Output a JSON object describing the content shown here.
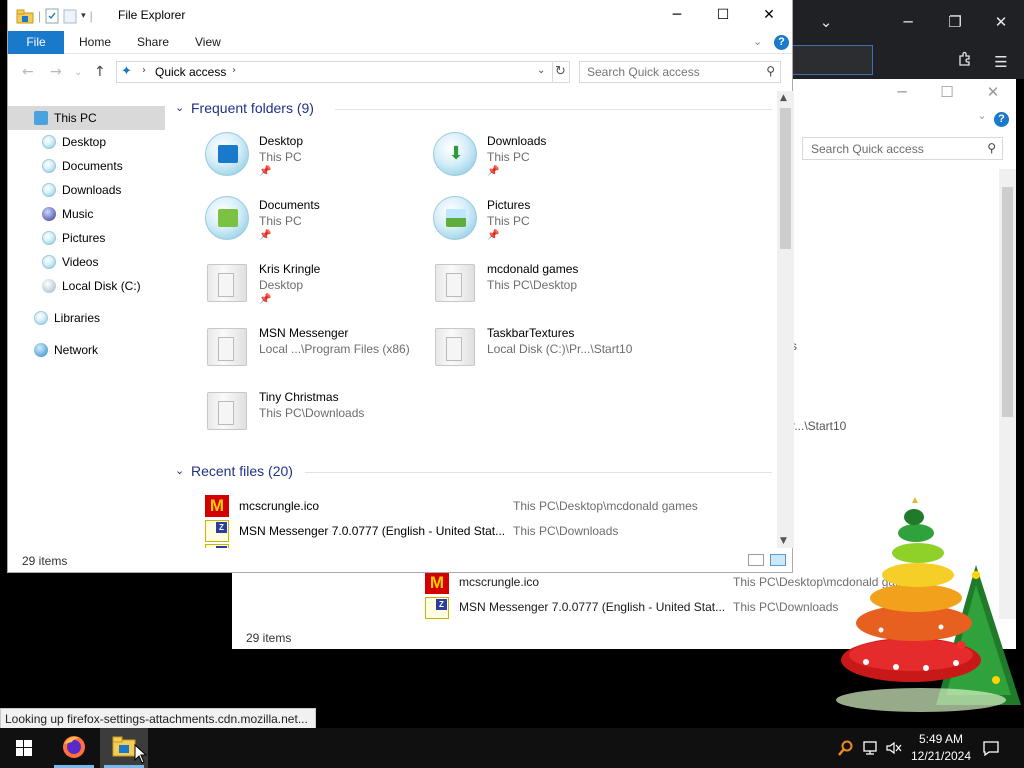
{
  "bg_browser": {
    "minimize": "─",
    "restore": "❐",
    "close": "✕",
    "dropdown": "⌄",
    "menu": "☰",
    "extensions_icon": "puzzle-icon"
  },
  "bg_explorer": {
    "search_placeholder": "Search Quick access",
    "fragment_1": "s",
    "fragment_2": "r...\\Start10",
    "status": "29 items",
    "files": [
      {
        "name": "mcscrungle.ico",
        "path": "This PC\\Desktop\\mcdonald games"
      },
      {
        "name": "MSN Messenger 7.0.0777 (English - United Stat...",
        "path": "This PC\\Downloads"
      }
    ]
  },
  "window": {
    "title": "File Explorer",
    "minimize": "─",
    "maximize": "☐",
    "close": "✕"
  },
  "ribbon": {
    "tabs": [
      "File",
      "Home",
      "Share",
      "View"
    ],
    "help": "?"
  },
  "address": {
    "back": "←",
    "forward": "→",
    "recent": "⌄",
    "up": "↑",
    "crumb": "Quick access",
    "refresh": "↻",
    "search_placeholder": "Search Quick access"
  },
  "nav": {
    "items": [
      {
        "label": "This PC"
      },
      {
        "label": "Desktop"
      },
      {
        "label": "Documents"
      },
      {
        "label": "Downloads"
      },
      {
        "label": "Music"
      },
      {
        "label": "Pictures"
      },
      {
        "label": "Videos"
      },
      {
        "label": "Local Disk (C:)"
      },
      {
        "label": "Libraries"
      },
      {
        "label": "Network"
      }
    ]
  },
  "frequent": {
    "title": "Frequent folders (9)",
    "folders": [
      {
        "name": "Desktop",
        "location": "This PC",
        "icon": "desktop-folder-icon",
        "pinned": true
      },
      {
        "name": "Downloads",
        "location": "This PC",
        "icon": "downloads-folder-icon",
        "pinned": true
      },
      {
        "name": "Documents",
        "location": "This PC",
        "icon": "documents-folder-icon",
        "pinned": true
      },
      {
        "name": "Pictures",
        "location": "This PC",
        "icon": "pictures-folder-icon",
        "pinned": true
      },
      {
        "name": "Kris Kringle",
        "location": "Desktop",
        "icon": "folder-icon",
        "pinned": true
      },
      {
        "name": "mcdonald games",
        "location": "This PC\\Desktop",
        "icon": "folder-icon",
        "pinned": false
      },
      {
        "name": "MSN Messenger",
        "location": "Local ...\\Program Files (x86)",
        "icon": "folder-icon",
        "pinned": false
      },
      {
        "name": "TaskbarTextures",
        "location": "Local Disk (C:)\\Pr...\\Start10",
        "icon": "folder-icon",
        "pinned": false
      },
      {
        "name": "Tiny Christmas",
        "location": "This PC\\Downloads",
        "icon": "folder-icon",
        "pinned": false
      }
    ]
  },
  "recent": {
    "title": "Recent files (20)",
    "files": [
      {
        "name": "mcscrungle.ico",
        "path": "This PC\\Desktop\\mcdonald games",
        "icon": "mcdonalds-icon"
      },
      {
        "name": "MSN Messenger 7.0.0777 (English - United Stat...",
        "path": "This PC\\Downloads",
        "icon": "msn-installer-icon"
      }
    ]
  },
  "status": {
    "count": "29 items"
  },
  "tooltip": {
    "text": "Looking up firefox-settings-attachments.cdn.mozilla.net..."
  },
  "taskbar": {
    "time": "5:49 AM",
    "date": "12/21/2024",
    "apps": [
      "firefox-icon",
      "file-explorer-icon"
    ]
  },
  "colors": {
    "accent": "#1979ca",
    "group_header": "#1e3287",
    "secondary_text": "#6d6d6d"
  }
}
